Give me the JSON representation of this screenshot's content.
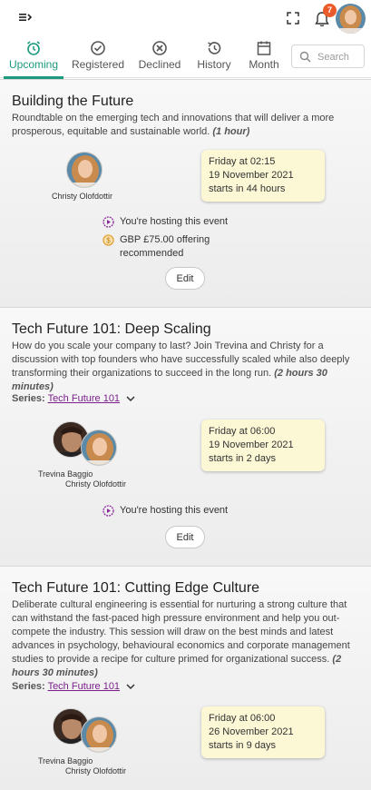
{
  "header": {
    "notification_count": "7"
  },
  "tabs": [
    {
      "label": "Upcoming",
      "icon": "alarm-clock-icon",
      "active": true
    },
    {
      "label": "Registered",
      "icon": "check-circle-icon"
    },
    {
      "label": "Declined",
      "icon": "x-circle-icon"
    },
    {
      "label": "History",
      "icon": "history-icon"
    },
    {
      "label": "Month",
      "icon": "calendar-icon"
    }
  ],
  "search": {
    "placeholder": "Search"
  },
  "colors": {
    "accent": "#1b9a7e",
    "link": "#7a1f8c",
    "badge": "#ea5a2a",
    "date_card": "#fcf7d5"
  },
  "events": [
    {
      "title": "Building the Future",
      "description": "Roundtable on the emerging tech and innovations that will deliver a more prosperous, equitable and sustainable world.",
      "duration": "(1 hour)",
      "hosts": [
        "Christy Olofdottir"
      ],
      "date": {
        "day": "Friday at 02:15",
        "date": "19 November 2021",
        "starts": "starts in 44 hours"
      },
      "hosting_text": "You're hosting this event",
      "price_line1": "GBP £75.00 offering",
      "price_line2": "recommended",
      "edit_label": "Edit"
    },
    {
      "title": "Tech Future 101: Deep Scaling",
      "description": "How do you scale your company to last? Join Trevina and Christy for a discussion with top founders who have successfully scaled while also deeply transforming their organizations to succeed in the long run.",
      "duration": "(2 hours 30 minutes)",
      "series_label": "Series:",
      "series_name": "Tech Future 101",
      "hosts": [
        "Trevina Baggio",
        "Christy Olofdottir"
      ],
      "date": {
        "day": "Friday at 06:00",
        "date": "19 November 2021",
        "starts": "starts in 2 days"
      },
      "hosting_text": "You're hosting this event",
      "edit_label": "Edit"
    },
    {
      "title": "Tech Future 101: Cutting Edge Culture",
      "description": "Deliberate cultural engineering is essential for nurturing a strong culture that can withstand the fast-paced high pressure environment and help you out-compete the industry. This session will draw on the best minds and latest advances in psychology, behavioural economics and corporate management studies to provide a recipe for culture primed for organizational success.",
      "duration": "(2 hours 30 minutes)",
      "series_label": "Series:",
      "series_name": "Tech Future 101",
      "hosts": [
        "Trevina Baggio",
        "Christy Olofdottir"
      ],
      "date": {
        "day": "Friday at 06:00",
        "date": "26 November 2021",
        "starts": "starts in 9 days"
      }
    }
  ]
}
